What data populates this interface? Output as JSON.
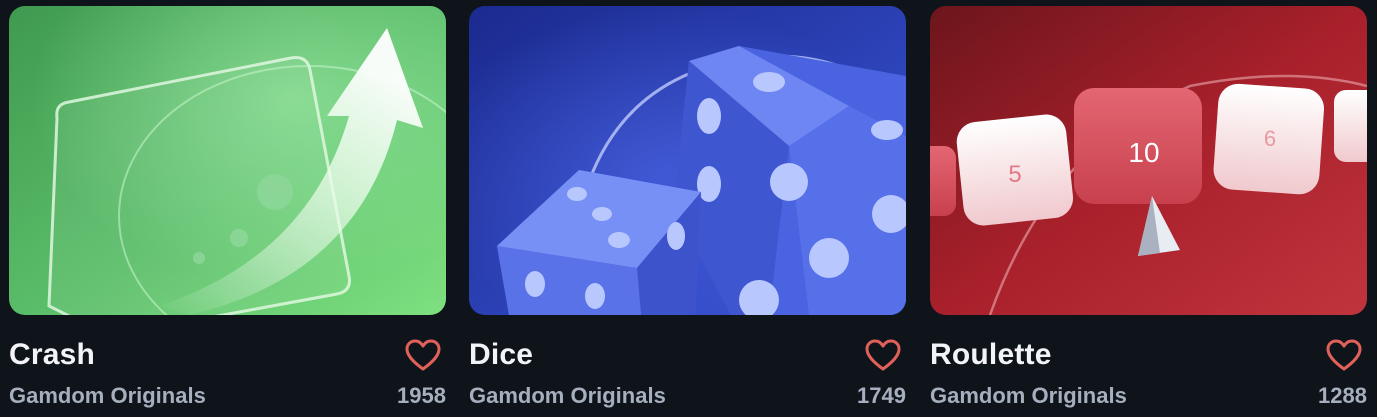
{
  "colors": {
    "background": "#0f141b",
    "favorite": "#e0605a",
    "crash_bg": "#56b866",
    "dice_bg": "#2a3fb8",
    "roulette_bg": "#b3232e"
  },
  "games": [
    {
      "title": "Crash",
      "provider": "Gamdom Originals",
      "count": "1958",
      "favorite_icon": "heart-outline-icon"
    },
    {
      "title": "Dice",
      "provider": "Gamdom Originals",
      "count": "1749",
      "favorite_icon": "heart-outline-icon"
    },
    {
      "title": "Roulette",
      "provider": "Gamdom Originals",
      "count": "1288",
      "favorite_icon": "heart-outline-icon"
    }
  ],
  "roulette_tiles": [
    "5",
    "10",
    "6"
  ]
}
